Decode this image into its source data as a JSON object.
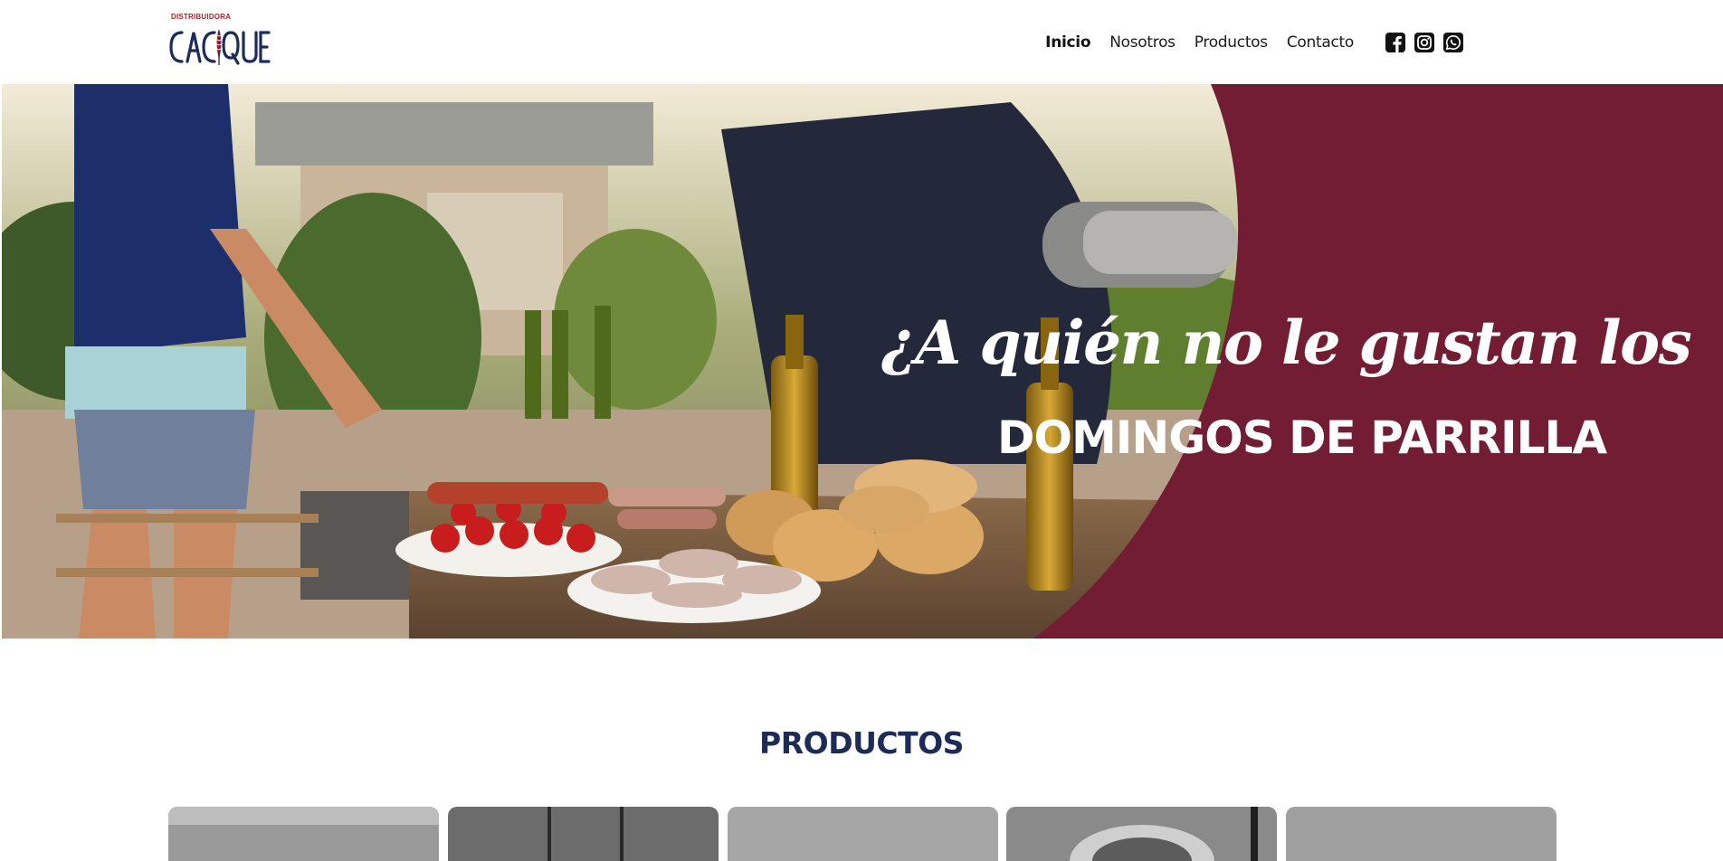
{
  "header": {
    "logo": {
      "top_text": "DISTRIBUIDORA",
      "name": "CACIQUE",
      "brand_colors": {
        "navy": "#1d2b57",
        "red": "#b3232a"
      }
    },
    "nav": {
      "items": [
        {
          "label": "Inicio",
          "active": true
        },
        {
          "label": "Nosotros",
          "active": false
        },
        {
          "label": "Productos",
          "active": false
        },
        {
          "label": "Contacto",
          "active": false
        }
      ]
    },
    "social": [
      {
        "icon": "facebook-icon"
      },
      {
        "icon": "instagram-icon"
      },
      {
        "icon": "whatsapp-icon"
      }
    ]
  },
  "hero": {
    "script_line": "¿A quién no le gustan los",
    "block_line": "DOMINGOS DE PARRILLA",
    "accent_color": "#721d33"
  },
  "products": {
    "title": "PRODUCTOS",
    "title_color": "#1d2b57",
    "card_count": 5
  }
}
